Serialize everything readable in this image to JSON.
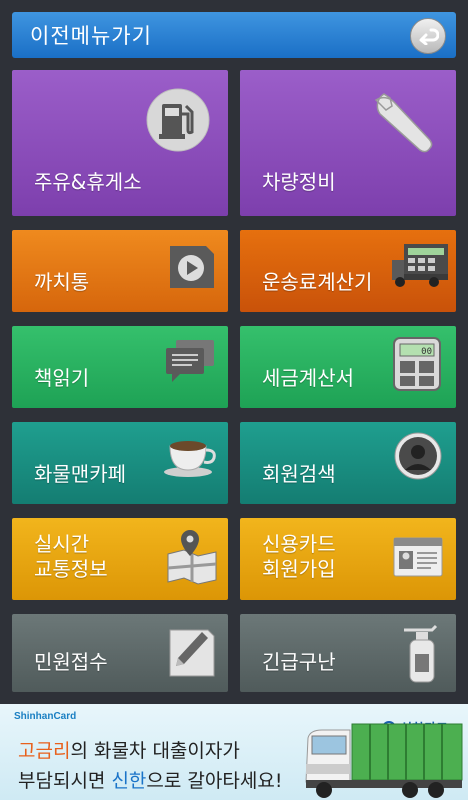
{
  "header": {
    "title": "이전메뉴가기"
  },
  "tiles": [
    {
      "label": "주유&휴게소",
      "icon": "gas-station-icon"
    },
    {
      "label": "차량정비",
      "icon": "wrench-icon"
    },
    {
      "label": "까치통",
      "icon": "play-icon"
    },
    {
      "label": "운송료계산기",
      "icon": "truck-calculator-icon"
    },
    {
      "label": "책읽기",
      "icon": "chat-bubbles-icon"
    },
    {
      "label": "세금계산서",
      "icon": "calculator-icon"
    },
    {
      "label": "화물맨카페",
      "icon": "coffee-cup-icon"
    },
    {
      "label": "회원검색",
      "icon": "user-avatar-icon"
    },
    {
      "label": "실시간\n교통정보",
      "icon": "map-pin-icon"
    },
    {
      "label": "신용카드\n회원가입",
      "icon": "id-card-icon"
    },
    {
      "label": "민원접수",
      "icon": "pencil-note-icon"
    },
    {
      "label": "긴급구난",
      "icon": "fire-extinguisher-icon"
    }
  ],
  "banner": {
    "brand": "ShinhanCard",
    "card_logo": "신한카드",
    "line1_highlight": "고금리",
    "line1_rest": "의 화물차 대출이자가",
    "line2_start": "부담되시면 ",
    "line2_highlight": "신한",
    "line2_end": "으로 갈아타세요!"
  }
}
